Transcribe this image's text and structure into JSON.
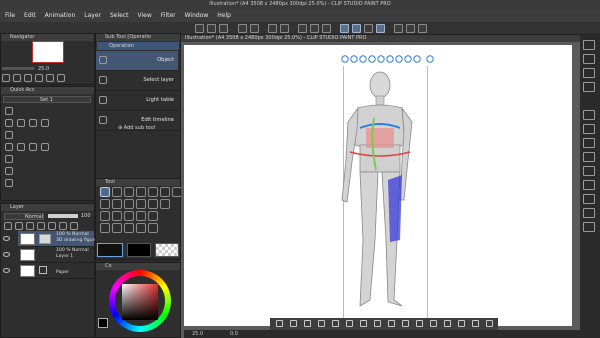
{
  "window": {
    "title": "Illustration* (A4 3508 x 2480px 300dpi 25.0%) - CLIP STUDIO PAINT PRO"
  },
  "menu": {
    "items": [
      "File",
      "Edit",
      "Animation",
      "Layer",
      "Select",
      "View",
      "Filter",
      "Window",
      "Help"
    ]
  },
  "navigator": {
    "title": "Navigator",
    "zoom": "25.0"
  },
  "subtool": {
    "title": "Sub Tool [Operatio",
    "group": "Operation",
    "items": [
      "Object",
      "Select layer",
      "Light table",
      "Edit timeline"
    ],
    "add_label": "Add sub tool"
  },
  "quick_access": {
    "title": "Quick Acc",
    "set": "Set 1"
  },
  "layer_panel": {
    "title": "Layer",
    "blend": "Normal",
    "opacity": "100",
    "layers": [
      {
        "line1": "100 % Normal",
        "line2": "3D drawing figure"
      },
      {
        "line1": "100 % Normal",
        "line2": "Layer 1"
      },
      {
        "line1": "",
        "line2": "Paper"
      }
    ]
  },
  "tool_panel": {
    "title": "Tool"
  },
  "color": {
    "title": "Co"
  },
  "status": {
    "zoom": "25.0",
    "angle": "0.0"
  },
  "colors": {
    "accent_selected": "#435774",
    "panel_bg": "#2e2e2e",
    "canvas": "#ffffff",
    "gizmo_blue": "#2f7fe0",
    "gizmo_red": "#e04040",
    "gizmo_green": "#7ac943"
  }
}
